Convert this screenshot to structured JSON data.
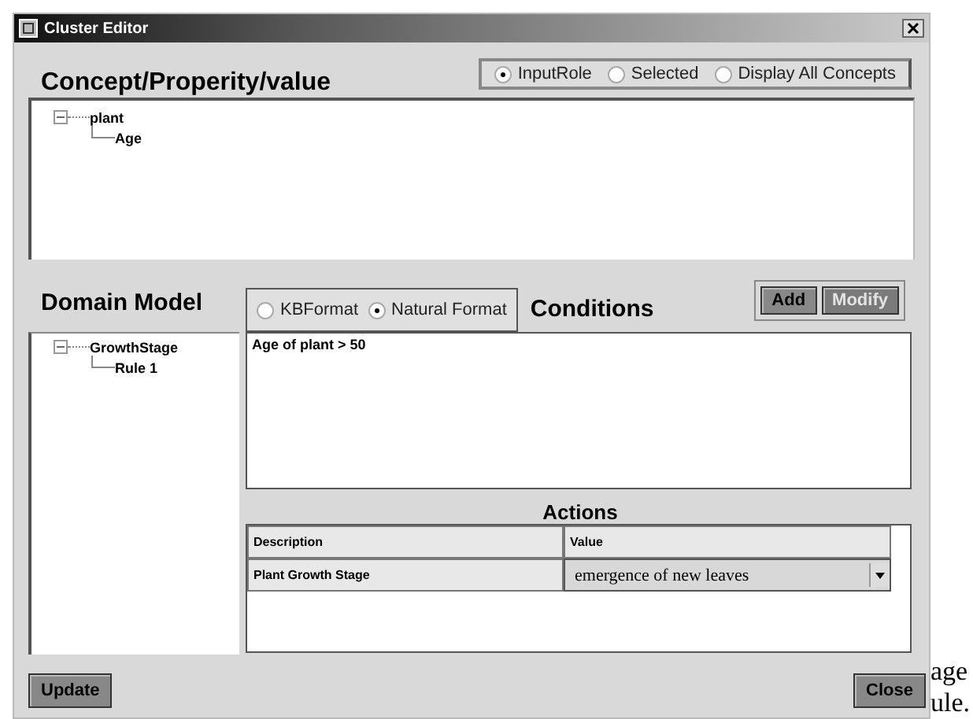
{
  "window": {
    "title": "Cluster Editor"
  },
  "concept_panel": {
    "title": "Concept/Properity/value",
    "view_options": [
      {
        "label": "InputRole",
        "selected": true
      },
      {
        "label": "Selected",
        "selected": false
      },
      {
        "label": "Display All Concepts",
        "selected": false
      }
    ],
    "tree": [
      {
        "label": "plant",
        "expanded": true,
        "children": [
          {
            "label": "Age"
          }
        ]
      }
    ]
  },
  "domain_model": {
    "title": "Domain Model",
    "tree": [
      {
        "label": "GrowthStage",
        "expanded": true,
        "children": [
          {
            "label": "Rule 1"
          }
        ]
      }
    ]
  },
  "conditions": {
    "title": "Conditions",
    "formats": [
      {
        "label": "KBFormat",
        "selected": false
      },
      {
        "label": "Natural Format",
        "selected": true
      }
    ],
    "buttons": [
      {
        "label": "Add",
        "disabled": false
      },
      {
        "label": "Modify",
        "disabled": true
      }
    ],
    "text": "Age of plant > 50"
  },
  "actions": {
    "title": "Actions",
    "columns": [
      "Description",
      "Value"
    ],
    "rows": [
      {
        "description": "Plant Growth Stage",
        "value": "emergence of new leaves"
      }
    ]
  },
  "footer_buttons": [
    "Update",
    "Close"
  ],
  "background_text": [
    "age",
    "ule."
  ]
}
